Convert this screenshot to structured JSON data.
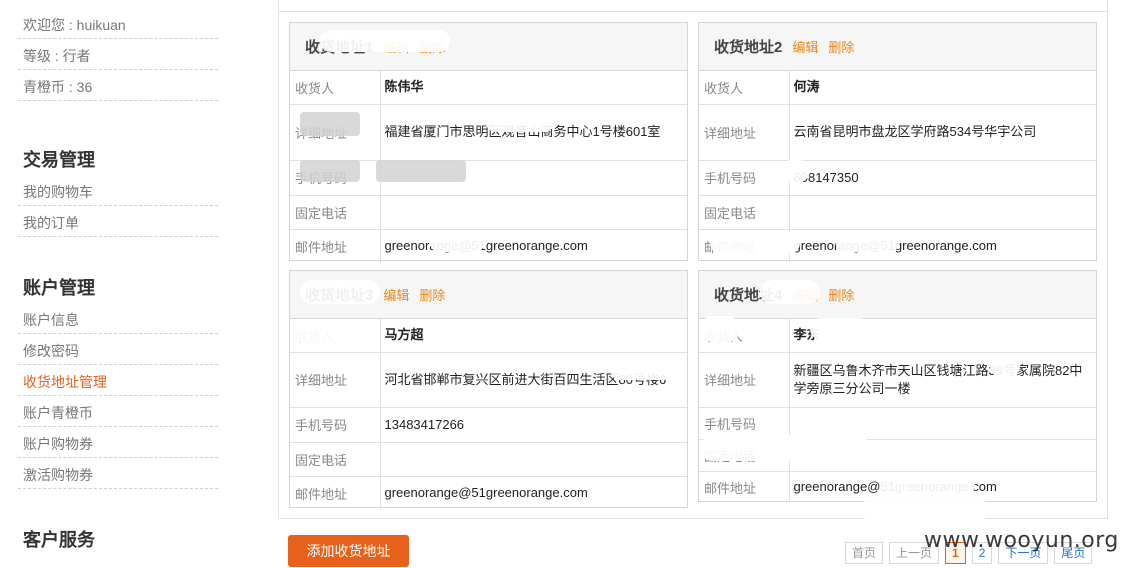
{
  "sidebar": {
    "welcome": "欢迎您 : huikuan",
    "level": "等级 : 行者",
    "coins": "青橙币 : 36",
    "trade_heading": "交易管理",
    "cart": "我的购物车",
    "orders": "我的订单",
    "account_heading": "账户管理",
    "account_info": "账户信息",
    "change_password": "修改密码",
    "address_mgmt": "收货地址管理",
    "account_coins": "账户青橙币",
    "account_coupons": "账户购物券",
    "activate_coupons": "激活购物券",
    "service_heading": "客户服务"
  },
  "labels": {
    "receiver": "收货人",
    "address": "详细地址",
    "mobile": "手机号码",
    "phone": "固定电话",
    "email": "邮件地址",
    "edit": "编辑",
    "delete": "删除"
  },
  "cards": [
    {
      "title": "收货地址1",
      "receiver": "陈伟华",
      "address": "福建省厦门市思明区观音山商务中心1号楼601室",
      "mobile": "",
      "phone": "",
      "email": "greenorange@51greenorange.com"
    },
    {
      "title": "收货地址2",
      "receiver": "何涛",
      "address": "云南省昆明市盘龙区学府路534号华宇公司",
      "mobile": "608147350",
      "phone": "",
      "email": "greenorange@51greenorange.com"
    },
    {
      "title": "收货地址3",
      "receiver": "马方超",
      "address": "河北省邯郸市复兴区前进大街百四生活区80号楼6",
      "mobile": "13483417266",
      "phone": "",
      "email": "greenorange@51greenorange.com"
    },
    {
      "title": "收货地址4",
      "receiver": "李东",
      "address": "新疆区乌鲁木齐市天山区钱塘江路38号家属院82中学旁原三分公司一楼",
      "mobile": "",
      "phone": "",
      "email": "greenorange@51greenorange.com"
    }
  ],
  "add_button": "添加收货地址",
  "pager": {
    "first": "首页",
    "prev": "上一页",
    "page1": "1",
    "page2": "2",
    "next": "下一页",
    "last": "尾页"
  },
  "watermark": "www.wooyun.org",
  "colors": {
    "accent": "#e8611a",
    "link": "#e8861a"
  }
}
